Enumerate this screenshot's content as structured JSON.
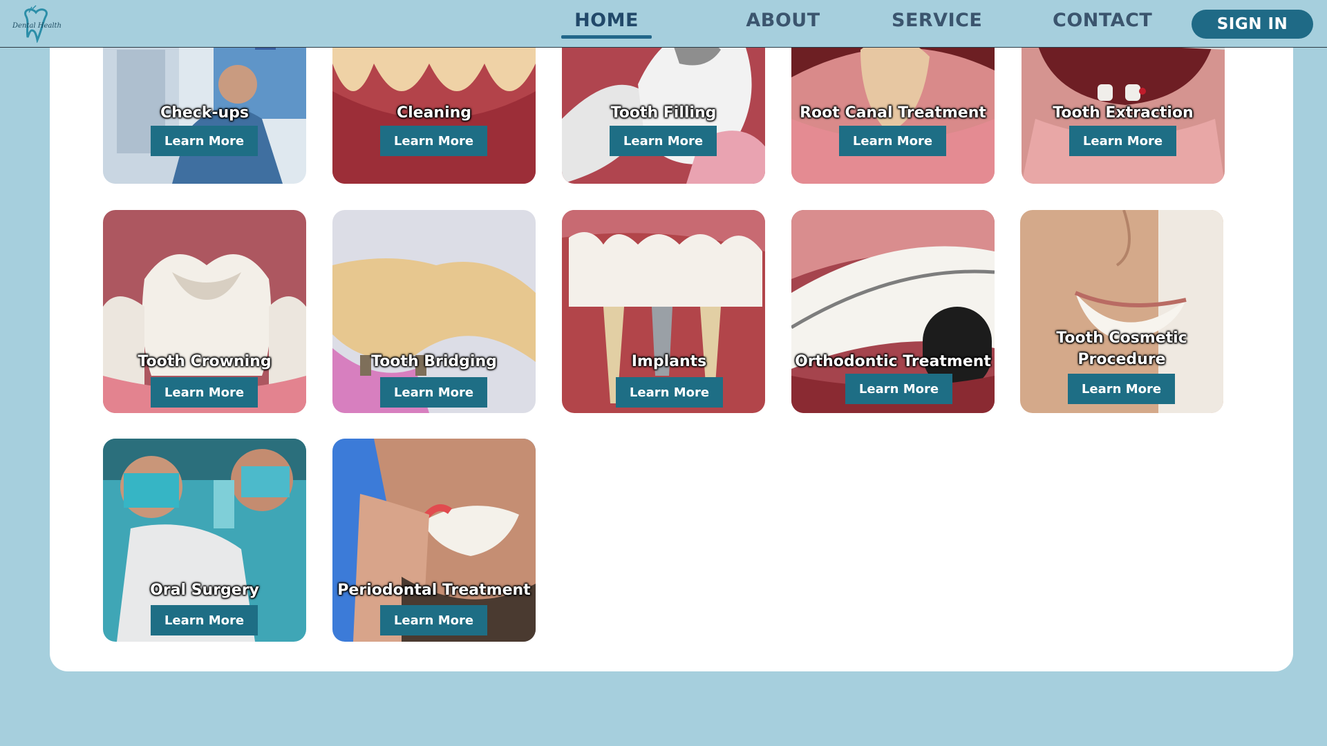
{
  "nav": {
    "home": "HOME",
    "about": "ABOUT",
    "service": "SERVICE",
    "contact": "CONTACT",
    "sign_in": "SIGN IN"
  },
  "services": [
    {
      "title": "Check-ups",
      "button": "Learn More"
    },
    {
      "title": "Cleaning",
      "button": "Learn More"
    },
    {
      "title": "Tooth Filling",
      "button": "Learn More"
    },
    {
      "title": "Root Canal Treatment",
      "button": "Learn More"
    },
    {
      "title": "Tooth Extraction",
      "button": "Learn More"
    },
    {
      "title": "Tooth Crowning",
      "button": "Learn More"
    },
    {
      "title": "Tooth Bridging",
      "button": "Learn More"
    },
    {
      "title": "Implants",
      "button": "Learn More"
    },
    {
      "title": "Orthodontic Treatment",
      "button": "Learn More"
    },
    {
      "title": "Tooth Cosmetic Procedure",
      "button": "Learn More"
    },
    {
      "title": "Oral Surgery",
      "button": "Learn More"
    },
    {
      "title": "Periodontal Treatment",
      "button": "Learn More"
    }
  ],
  "colors": {
    "background": "#a6cfdd",
    "button": "#1e6e85",
    "nav_text": "#3b556e"
  }
}
